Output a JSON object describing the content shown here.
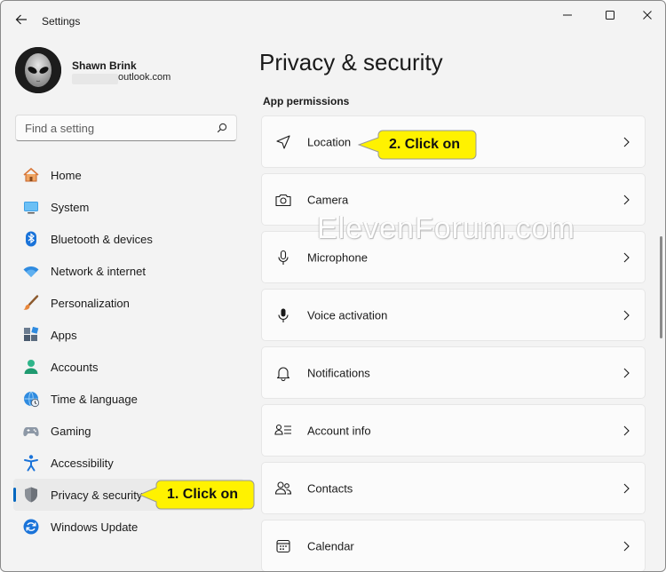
{
  "window": {
    "title": "Settings"
  },
  "profile": {
    "name": "Shawn Brink",
    "email": "outlook.com"
  },
  "search": {
    "placeholder": "Find a setting"
  },
  "nav": {
    "items": [
      {
        "label": "Home",
        "icon": "home-icon"
      },
      {
        "label": "System",
        "icon": "system-icon"
      },
      {
        "label": "Bluetooth & devices",
        "icon": "bluetooth-icon"
      },
      {
        "label": "Network & internet",
        "icon": "network-icon"
      },
      {
        "label": "Personalization",
        "icon": "brush-icon"
      },
      {
        "label": "Apps",
        "icon": "apps-icon"
      },
      {
        "label": "Accounts",
        "icon": "accounts-icon"
      },
      {
        "label": "Time & language",
        "icon": "globe-clock-icon"
      },
      {
        "label": "Gaming",
        "icon": "gamepad-icon"
      },
      {
        "label": "Accessibility",
        "icon": "accessibility-icon"
      },
      {
        "label": "Privacy & security",
        "icon": "shield-icon",
        "selected": true
      },
      {
        "label": "Windows Update",
        "icon": "update-icon"
      }
    ]
  },
  "main": {
    "title": "Privacy & security",
    "section": "App permissions",
    "items": [
      {
        "label": "Location",
        "icon": "location-icon"
      },
      {
        "label": "Camera",
        "icon": "camera-icon"
      },
      {
        "label": "Microphone",
        "icon": "microphone-icon"
      },
      {
        "label": "Voice activation",
        "icon": "voice-activation-icon"
      },
      {
        "label": "Notifications",
        "icon": "bell-icon"
      },
      {
        "label": "Account info",
        "icon": "account-info-icon"
      },
      {
        "label": "Contacts",
        "icon": "contacts-icon"
      },
      {
        "label": "Calendar",
        "icon": "calendar-icon"
      }
    ]
  },
  "callouts": {
    "step1": "1. Click on",
    "step2": "2. Click on"
  },
  "watermark": "ElevenForum.com",
  "colors": {
    "accent": "#0067c0",
    "callout_fill": "#fff200",
    "background": "#f3f3f3",
    "card": "#fbfbfb"
  }
}
